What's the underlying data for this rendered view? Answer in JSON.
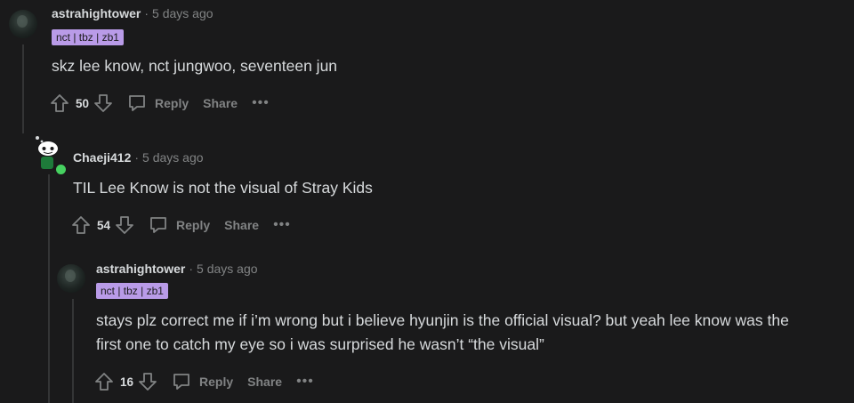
{
  "comments": [
    {
      "author": "astrahightower",
      "time": "5 days ago",
      "flair": "nct | tbz | zb1",
      "text": "skz lee know, nct jungwoo, seventeen jun",
      "votes": "50",
      "reply_label": "Reply",
      "share_label": "Share",
      "avatar_icon": "avatar-image"
    },
    {
      "author": "Chaeji412",
      "time": "5 days ago",
      "text": "TIL Lee Know is not the visual of Stray Kids",
      "votes": "54",
      "reply_label": "Reply",
      "share_label": "Share",
      "avatar_icon": "snoo-avatar-icon",
      "online_color": "#46d160"
    },
    {
      "author": "astrahightower",
      "time": "5 days ago",
      "flair": "nct | tbz | zb1",
      "text_line1": "stays plz correct me if i’m wrong but i believe hyunjin is the official visual? but yeah lee know was the",
      "text_line2": "first one to catch my eye so i was surprised he wasn’t “the visual”",
      "votes": "16",
      "reply_label": "Reply",
      "share_label": "Share",
      "avatar_icon": "avatar-image"
    }
  ],
  "dot_separator": "·",
  "more_label": "•••",
  "colors": {
    "background": "#1a1a1b",
    "text": "#d7dadc",
    "muted": "#818384",
    "flair_bg": "#b99be8",
    "thread_line": "#343536"
  }
}
